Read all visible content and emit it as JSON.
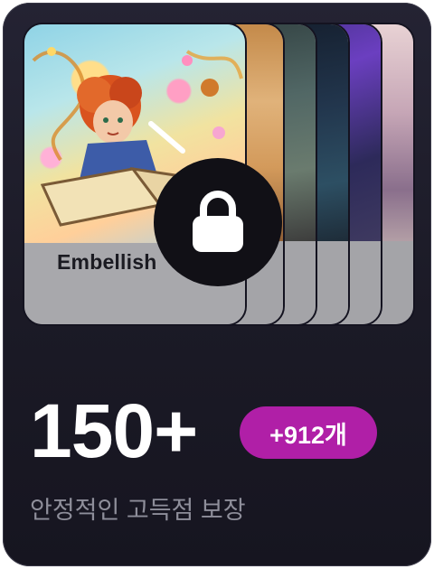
{
  "tiles": [
    {
      "label": "Embellish",
      "locked": true
    },
    {
      "label": ""
    },
    {
      "label": ""
    },
    {
      "label": ""
    },
    {
      "label": ""
    },
    {
      "label": ""
    }
  ],
  "stats": {
    "count": "150+",
    "badge": "+912개",
    "subtitle": "안정적인 고득점 보장"
  },
  "colors": {
    "card_bg": "#1c1b27",
    "badge_bg": "#b01fa7",
    "subtitle": "#8e8e9a",
    "lock_bg": "#111016"
  },
  "icons": {
    "lock": "lock-icon"
  }
}
